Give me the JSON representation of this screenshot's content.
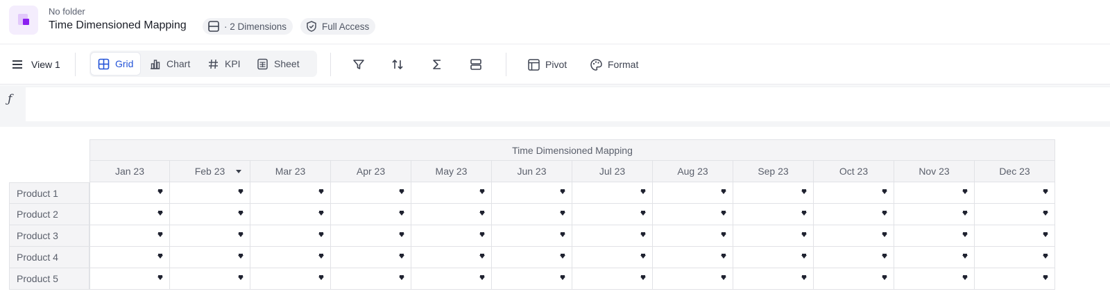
{
  "header": {
    "folder": "No folder",
    "title": "Time Dimensioned Mapping",
    "dimensions_chip": "· 2 Dimensions",
    "access_chip": "Full Access"
  },
  "toolbar": {
    "view_label": "View 1",
    "tabs": [
      {
        "label": "Grid",
        "icon": "grid-icon",
        "active": true
      },
      {
        "label": "Chart",
        "icon": "bar-chart-icon",
        "active": false
      },
      {
        "label": "KPI",
        "icon": "hash-icon",
        "active": false
      },
      {
        "label": "Sheet",
        "icon": "sheet-icon",
        "active": false
      }
    ],
    "icon_buttons": [
      "filter-icon",
      "sort-icon",
      "sum-icon",
      "group-icon"
    ],
    "pivot_label": "Pivot",
    "format_label": "Format"
  },
  "formula_bar": {
    "symbol": "ƒ",
    "value": ""
  },
  "grid": {
    "title": "Time Dimensioned Mapping",
    "columns": [
      "Jan 23",
      "Feb 23",
      "Mar 23",
      "Apr 23",
      "May 23",
      "Jun 23",
      "Jul 23",
      "Aug 23",
      "Sep 23",
      "Oct 23",
      "Nov 23",
      "Dec 23"
    ],
    "rows": [
      "Product 1",
      "Product 2",
      "Product 3",
      "Product 4",
      "Product 5"
    ],
    "header_dropdown_column": "Feb 23"
  },
  "colors": {
    "accent": "#2353d8",
    "brand": "#8a1ff0"
  }
}
